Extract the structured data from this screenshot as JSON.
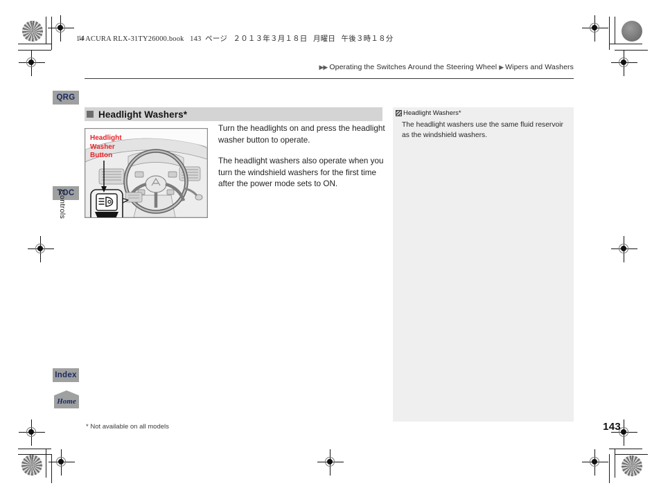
{
  "print": {
    "book_line": "14 ACURA RLX-31TY26000.book",
    "page_marker": "143",
    "page_unit": "ページ",
    "date": "２０１３年３月１８日",
    "weekday": "月曜日",
    "time": "午後３時１８分",
    "corner_label": "14"
  },
  "breadcrumb": {
    "arrow_double": "▶▶",
    "arrow_single": "▶",
    "level1": "Operating the Switches Around the Steering Wheel",
    "level2": "Wipers and Washers"
  },
  "sidebar": {
    "tabs": [
      {
        "id": "qrg",
        "label": "QRG"
      },
      {
        "id": "toc",
        "label": "TOC"
      },
      {
        "id": "index",
        "label": "Index"
      }
    ],
    "section_label": "Controls",
    "home_label": "Home"
  },
  "section": {
    "title": "Headlight Washers*",
    "bullet_icon": "filled-square-icon"
  },
  "figure": {
    "name": "steering-wheel-headlight-washer-button-illustration",
    "callout": "Headlight\nWasher\nButton",
    "callout_line1": "Headlight",
    "callout_line2": "Washer",
    "callout_line3": "Button",
    "button_icon": "headlight-washer-button-icon"
  },
  "body": {
    "paragraphs": [
      "Turn the headlights on and press the headlight washer button to operate.",
      "The headlight washers also operate when you turn the windshield washers for the first time after the power mode sets to ON."
    ]
  },
  "note": {
    "icon": "note-checker-glyph",
    "heading": "Headlight Washers*",
    "text": "The headlight washers use the same fluid reservoir as the windshield washers."
  },
  "footer": {
    "footnote": "* Not available on all models",
    "page_number": "143"
  },
  "colors": {
    "callout_red": "#e8232a",
    "tab_gray": "#9fa0a0",
    "tab_text_navy": "#1b2a5e",
    "section_bar_gray": "#d4d4d4",
    "note_panel_gray": "#efefef"
  }
}
